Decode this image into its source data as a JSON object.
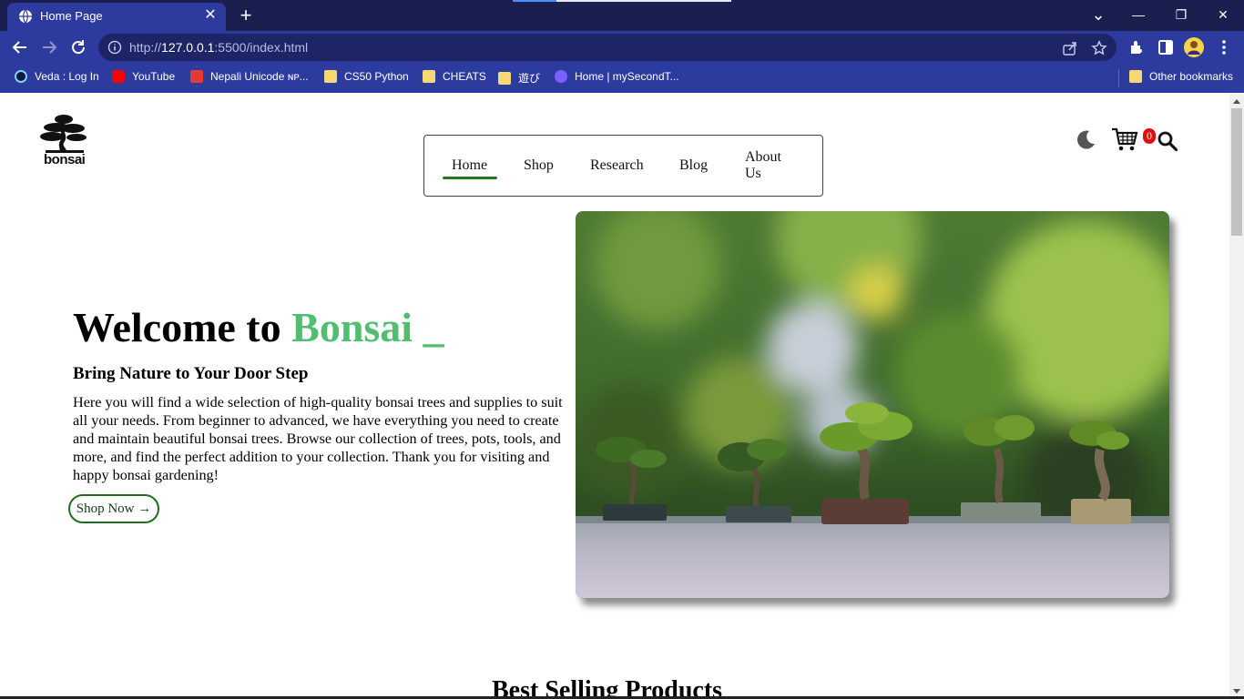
{
  "browser": {
    "tab_title": "Home Page",
    "tab_close": "✕",
    "new_tab": "+",
    "url_prefix": "http://",
    "url_host": "127.0.0.1",
    "url_rest": ":5500/index.html",
    "window": {
      "minimize": "—",
      "restore": "❐",
      "close": "✕",
      "tab_search": "⌄"
    }
  },
  "bookmarks": [
    {
      "label": "Veda : Log In",
      "icon": "veda-icon",
      "color": "#0f1a3c"
    },
    {
      "label": "YouTube",
      "icon": "youtube-icon",
      "color": "#ff0000"
    },
    {
      "label": "Nepali Unicode ɴᴘ...",
      "icon": "nepali-unicode-icon",
      "color": "#e53935"
    },
    {
      "label": "CS50 Python",
      "icon": "folder-icon",
      "color": "#f7d774"
    },
    {
      "label": "CHEATS",
      "icon": "folder-icon",
      "color": "#f7d774"
    },
    {
      "label": "遊び",
      "icon": "folder-icon",
      "color": "#f7d774"
    },
    {
      "label": "Home | mySecondT...",
      "icon": "site-icon",
      "color": "#7b61ff"
    }
  ],
  "other_bookmarks": "Other bookmarks",
  "site": {
    "logo_text": "bonsai",
    "nav": [
      {
        "label": "Home"
      },
      {
        "label": "Shop"
      },
      {
        "label": "Research"
      },
      {
        "label": "Blog"
      },
      {
        "label": "About Us"
      }
    ],
    "cart_count": "0"
  },
  "hero": {
    "title_prefix": "Welcome to ",
    "title_accent": "Bonsai _",
    "subtitle": "Bring Nature to Your Door Step",
    "body": "Here you will find a wide selection of high-quality bonsai trees and supplies to suit all your needs. From beginner to advanced, we have everything you need to create and maintain beautiful bonsai trees. Browse our collection of trees, pots, tools, and more, and find the perfect addition to your collection. Thank you for visiting and happy bonsai gardening!",
    "cta": "Shop Now →"
  },
  "section": {
    "title": "Best Selling Products"
  },
  "colors": {
    "accent": "#4fbf6f",
    "nav_underline": "#1f7a1f",
    "badge": "#e01010",
    "chrome": "#2d3a9e",
    "tabstrip": "#1b1f4f"
  }
}
